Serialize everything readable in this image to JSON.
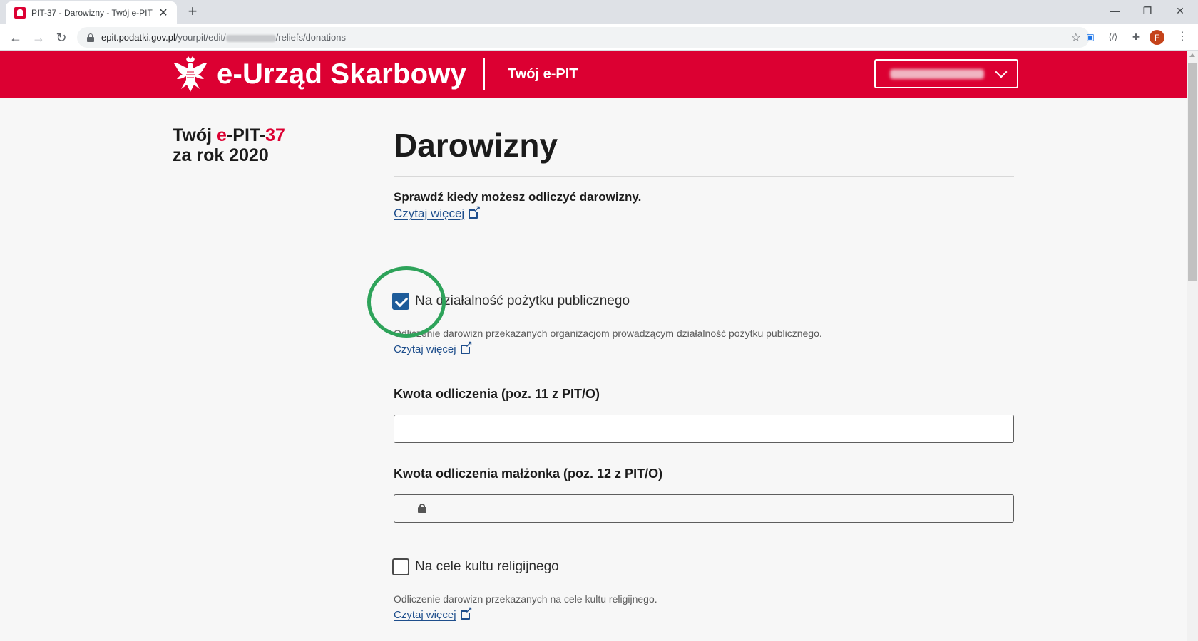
{
  "browser": {
    "tab_title": "PIT-37 - Darowizny - Twój e-PIT",
    "tab_close": "✕",
    "new_tab": "+",
    "url_host": "epit.podatki.gov.pl",
    "url_path_before": "/yourpit/edit/",
    "url_path_after": "/reliefs/donations",
    "profile_initial": "F",
    "window_controls": {
      "minimize": "—",
      "restore": "❐",
      "close": "✕"
    }
  },
  "header": {
    "site_title": "e-Urząd Skarbowy",
    "service_name": "Twój e-PIT"
  },
  "sidebar": {
    "title_prefix": "Twój ",
    "title_e": "e",
    "title_mid": "-PIT-",
    "title_num": "37",
    "title_line2": "za rok 2020"
  },
  "main": {
    "title": "Darowizny",
    "intro": "Sprawdź kiedy możesz odliczyć darowizny.",
    "read_more": "Czytaj więcej",
    "sections": [
      {
        "checkbox_label": "Na działalność pożytku publicznego",
        "checked": true,
        "help": "Odliczenie darowizn przekazanych organizacjom prowadzącym działalność pożytku publicznego.",
        "link": "Czytaj więcej"
      },
      {
        "checkbox_label": "Na cele kultu religijnego",
        "checked": false,
        "help": "Odliczenie darowizn przekazanych na cele kultu religijnego.",
        "link": "Czytaj więcej"
      }
    ],
    "fields": [
      {
        "label": "Kwota odliczenia (poz. 11 z PIT/O)",
        "value": "",
        "locked": false
      },
      {
        "label": "Kwota odliczenia małżonka (poz. 12 z PIT/O)",
        "value": "",
        "locked": true
      }
    ]
  },
  "colors": {
    "brand_red": "#dc0032",
    "link_blue": "#1e4e8c",
    "checkbox_blue": "#1e5c9a",
    "highlight_green": "#2ea35a"
  }
}
